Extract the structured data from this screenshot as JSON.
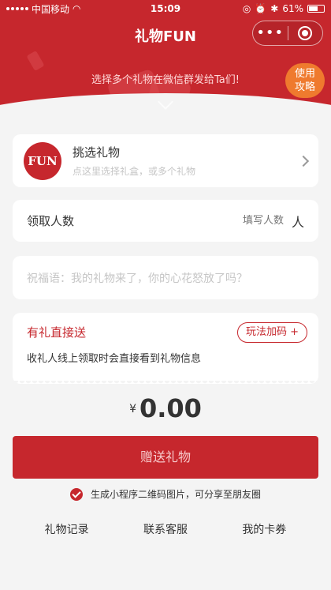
{
  "status_bar": {
    "carrier": "中国移动",
    "time": "15:09",
    "battery": "61%",
    "icons": [
      "signal-icon",
      "wifi-icon",
      "orientation-lock-icon",
      "alarm-icon",
      "bluetooth-icon",
      "battery-icon"
    ]
  },
  "nav": {
    "title": "礼物FUN",
    "more_glyph": "•••",
    "icons": [
      "more-icon",
      "target-icon"
    ]
  },
  "header": {
    "tip": "选择多个礼物在微信群发给Ta们!",
    "guide_line1": "使用",
    "guide_line2": "攻略",
    "icons": [
      "chevron-down-icon"
    ]
  },
  "pick_gift": {
    "logo_text": "FUN",
    "title": "挑选礼物",
    "subtitle": "点这里选择礼盒，或多个礼物"
  },
  "receive_count": {
    "label": "领取人数",
    "placeholder": "填写人数",
    "unit": "人"
  },
  "blessing": {
    "placeholder": "祝福语：我的礼物来了，你的心花怒放了吗？"
  },
  "direct_send": {
    "title": "有礼直接送",
    "play_button": "玩法加码 +",
    "description": "收礼人线上领取时会直接看到礼物信息"
  },
  "amount": {
    "currency": "¥",
    "value": "0.00"
  },
  "send_button": "赠送礼物",
  "qr_option": {
    "checked": true,
    "label": "生成小程序二维码图片，可分享至朋友圈"
  },
  "bottom_links": [
    "礼物记录",
    "联系客服",
    "我的卡券"
  ],
  "colors": {
    "brand_red": "#c6272d",
    "guide_orange": "#ef7a2e",
    "background": "#f4f4f4"
  }
}
